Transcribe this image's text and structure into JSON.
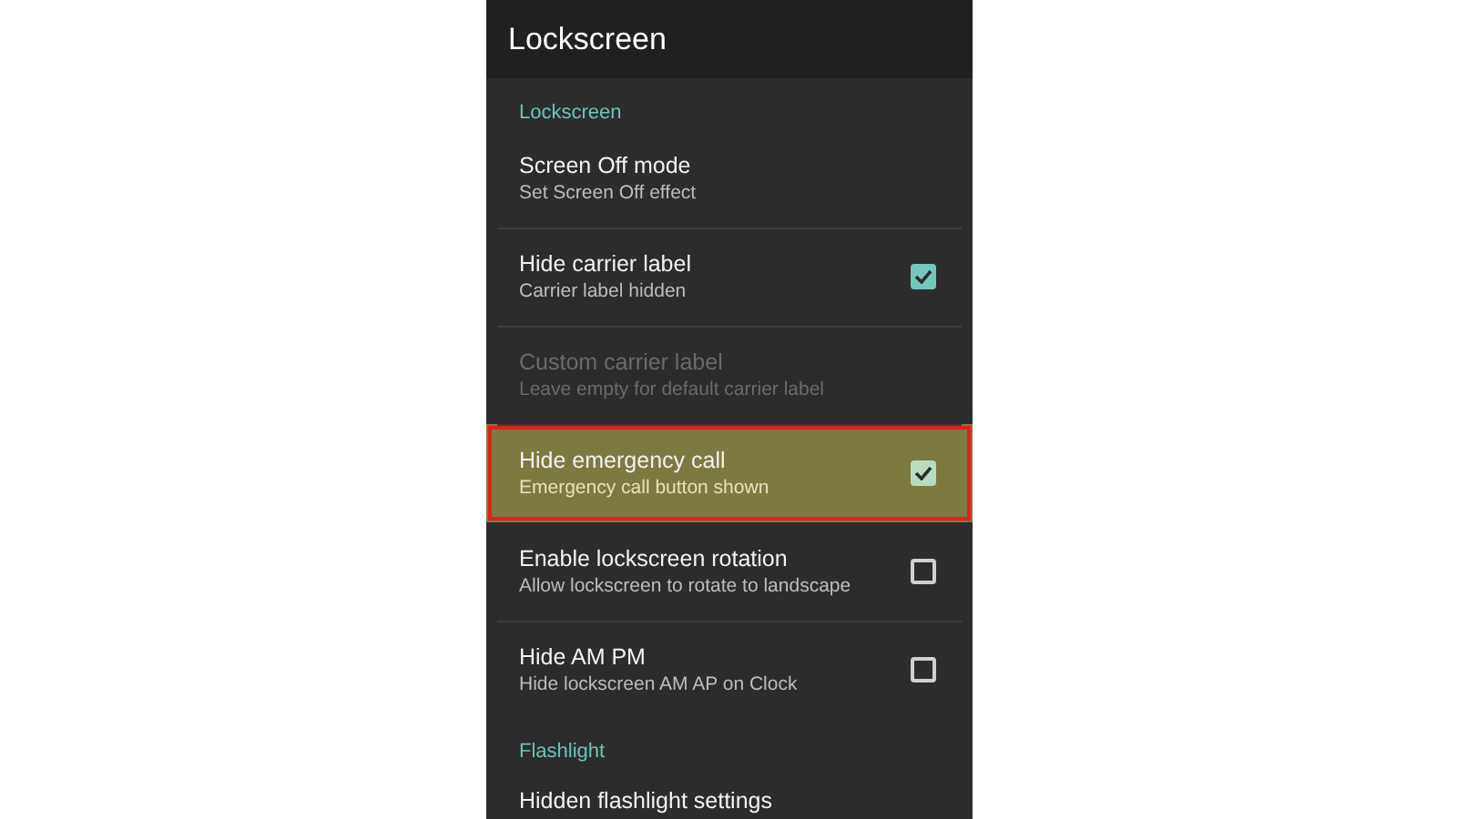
{
  "window": {
    "title": "Lockscreen"
  },
  "sections": [
    {
      "header": "Lockscreen",
      "items": [
        {
          "kind": "plain",
          "title": "Screen Off mode",
          "summary": "Set Screen Off effect",
          "disabled": false,
          "highlighted": false
        },
        {
          "kind": "checkbox",
          "title": "Hide carrier label",
          "summary": "Carrier label hidden",
          "checked": true,
          "disabled": false,
          "highlighted": false
        },
        {
          "kind": "plain",
          "title": "Custom carrier label",
          "summary": "Leave empty for default carrier label",
          "disabled": true,
          "highlighted": false
        },
        {
          "kind": "checkbox",
          "title": "Hide emergency call",
          "summary": "Emergency call button shown",
          "checked": true,
          "disabled": false,
          "highlighted": true
        },
        {
          "kind": "checkbox",
          "title": "Enable lockscreen rotation",
          "summary": "Allow lockscreen to rotate to landscape",
          "checked": false,
          "disabled": false,
          "highlighted": false
        },
        {
          "kind": "checkbox",
          "title": "Hide AM PM",
          "summary": "Hide lockscreen AM AP on Clock",
          "checked": false,
          "disabled": false,
          "highlighted": false
        }
      ]
    },
    {
      "header": "Flashlight",
      "items": [
        {
          "kind": "plain",
          "title": "Hidden flashlight settings",
          "disabled": false,
          "highlighted": false
        }
      ]
    }
  ]
}
